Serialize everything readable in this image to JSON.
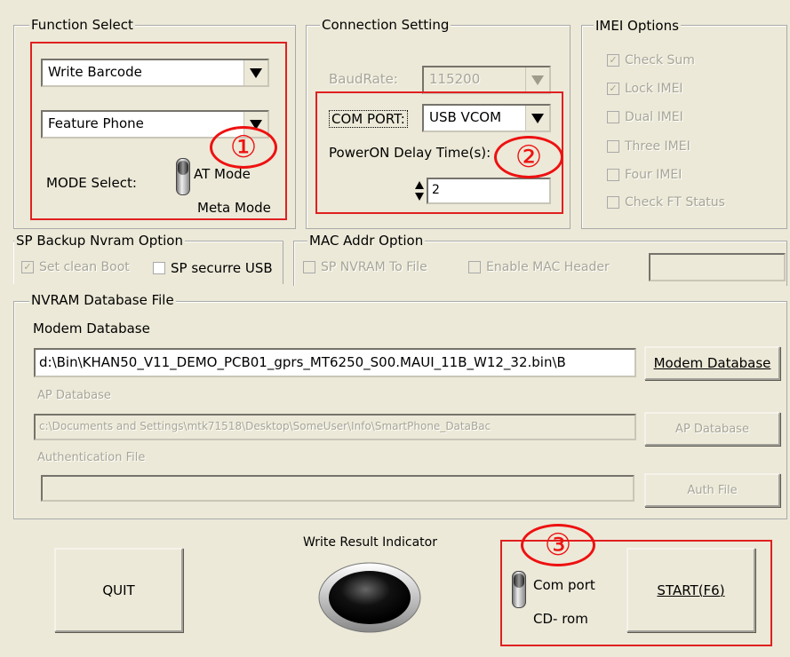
{
  "function_select": {
    "legend": "Function Select",
    "function_value": "Write Barcode",
    "phone_type_value": "Feature Phone",
    "mode_label": "MODE Select:",
    "mode_option_1": "AT Mode",
    "mode_option_2": "Meta Mode"
  },
  "connection": {
    "legend": "Connection Setting",
    "baudrate_label": "BaudRate:",
    "baudrate_value": "115200",
    "com_port_label": "COM PORT:",
    "com_port_value": "USB VCOM",
    "delay_label": "PowerON Delay Time(s):",
    "delay_value": "2"
  },
  "imei": {
    "legend": "IMEI Options",
    "options": [
      {
        "label": "Check Sum",
        "checked": true
      },
      {
        "label": "Lock IMEI",
        "checked": true
      },
      {
        "label": "Dual IMEI",
        "checked": false
      },
      {
        "label": "Three IMEI",
        "checked": false
      },
      {
        "label": "Four IMEI",
        "checked": false
      },
      {
        "label": "Check FT Status",
        "checked": false
      }
    ]
  },
  "sp_backup": {
    "legend": "SP Backup Nvram Option",
    "set_clean_boot": "Set clean Boot",
    "sp_secure_usb": "SP securre USB"
  },
  "mac": {
    "legend": "MAC Addr Option",
    "sp_nvram_to_file": "SP NVRAM To File",
    "enable_mac_header": "Enable MAC Header",
    "value": ""
  },
  "nvram": {
    "legend": "NVRAM Database File",
    "modem_label": "Modem Database",
    "modem_path": "d:\\Bin\\KHAN50_V11_DEMO_PCB01_gprs_MT6250_S00.MAUI_11B_W12_32.bin\\B",
    "modem_button": "Modem Database",
    "ap_label": "AP Database",
    "ap_path": "c:\\Documents and Settings\\mtk71518\\Desktop\\SomeUser\\Info\\SmartPhone_DataBac",
    "ap_button": "AP Database",
    "auth_label": "Authentication File",
    "auth_path": "",
    "auth_button": "Auth File"
  },
  "bottom": {
    "quit_button": "QUIT",
    "indicator_label": "Write Result Indicator",
    "com_port_label": "Com port",
    "cd_rom_label": "CD- rom",
    "start_button": "START(F6)"
  },
  "annotations": [
    "①",
    "②",
    "③"
  ],
  "colors": {
    "annotation": "#ee1111",
    "background": "#ece9d8"
  }
}
